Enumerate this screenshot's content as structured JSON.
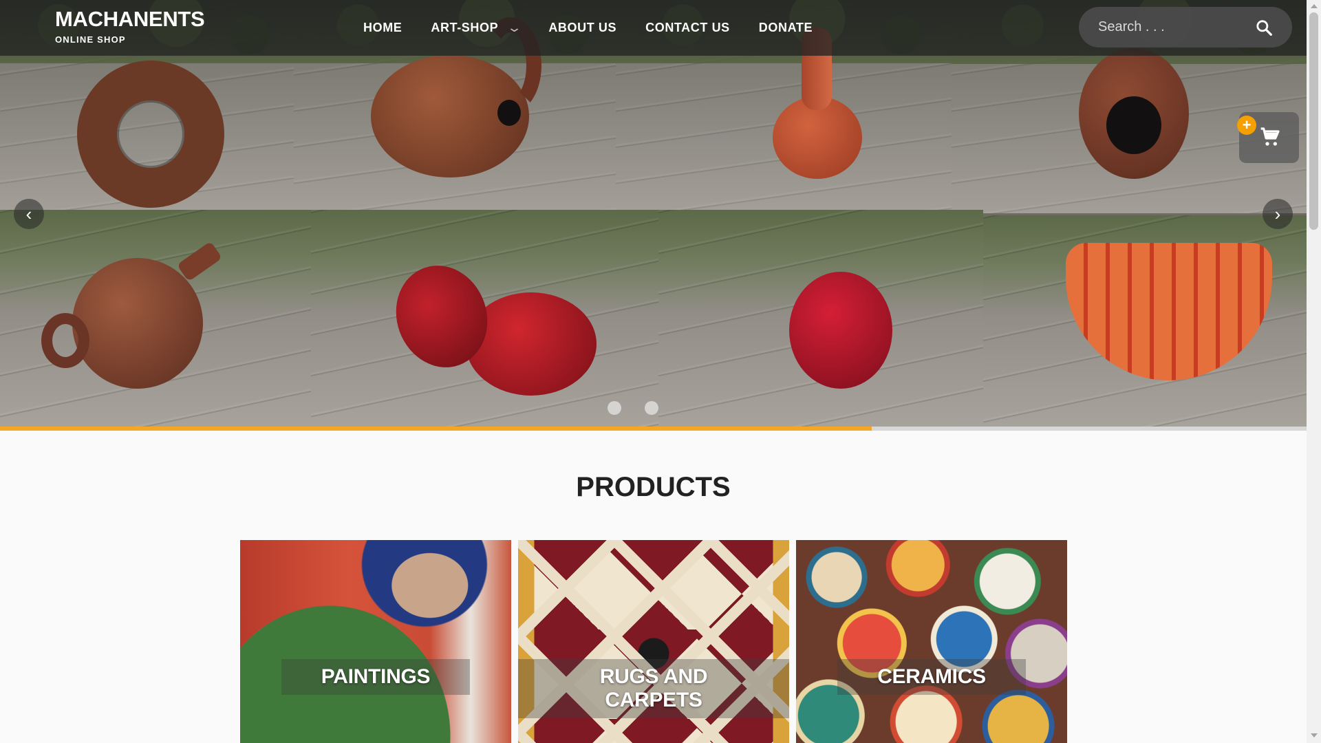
{
  "brand": {
    "title": "MACHANENTS",
    "subtitle": "ONLINE SHOP"
  },
  "nav": {
    "items": [
      {
        "label": "HOME"
      },
      {
        "label": "ART-SHOP"
      },
      {
        "label": "ABOUT US"
      },
      {
        "label": "CONTACT US"
      },
      {
        "label": "DONATE"
      }
    ],
    "art_shop_dropdown_icon": "chevron-down-icon"
  },
  "search": {
    "placeholder": "Search . . .",
    "icon": "search-icon"
  },
  "cart": {
    "icon": "shopping-cart-icon",
    "badge": "+"
  },
  "carousel": {
    "prev_icon": "chevron-left-icon",
    "next_icon": "chevron-right-icon",
    "slide_count": 2,
    "progress": 0.667,
    "progress_color": "#f5a623"
  },
  "products": {
    "title": "PRODUCTS",
    "items": [
      {
        "label": "PAINTINGS"
      },
      {
        "label": "RUGS AND CARPETS"
      },
      {
        "label": "CERAMICS"
      }
    ]
  },
  "colors": {
    "accent": "#f5a000",
    "header_bg": "#222222",
    "text_dark": "#222222"
  }
}
